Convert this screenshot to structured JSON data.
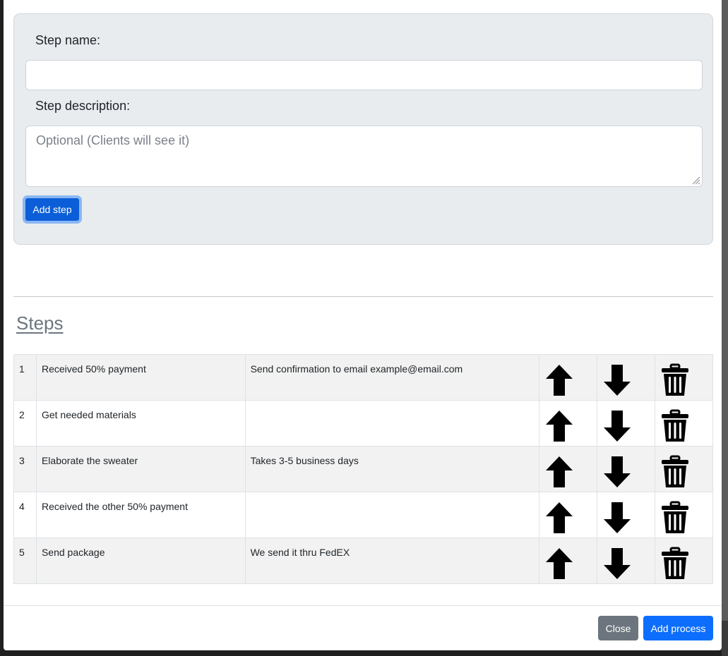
{
  "form": {
    "step_name_label": "Step name:",
    "step_name_value": "",
    "step_description_label": "Step description:",
    "step_description_placeholder": "Optional (Clients will see it)",
    "add_step_label": "Add step"
  },
  "steps_heading": "Steps",
  "steps": [
    {
      "num": "1",
      "name": "Received 50% payment",
      "description": "Send confirmation to email example@email.com"
    },
    {
      "num": "2",
      "name": "Get needed materials",
      "description": ""
    },
    {
      "num": "3",
      "name": "Elaborate the sweater",
      "description": "Takes 3-5 business days"
    },
    {
      "num": "4",
      "name": "Received the other 50% payment",
      "description": ""
    },
    {
      "num": "5",
      "name": "Send package",
      "description": "We send it thru FedEX"
    }
  ],
  "row_icons": [
    "arrow-up-icon",
    "arrow-down-icon",
    "trash-icon"
  ],
  "footer": {
    "close_label": "Close",
    "add_process_label": "Add process"
  },
  "colors": {
    "primary": "#0d6efd",
    "primary_focused": "#0b5ed7",
    "secondary": "#6c757d",
    "card_bg": "#e9ecef"
  }
}
